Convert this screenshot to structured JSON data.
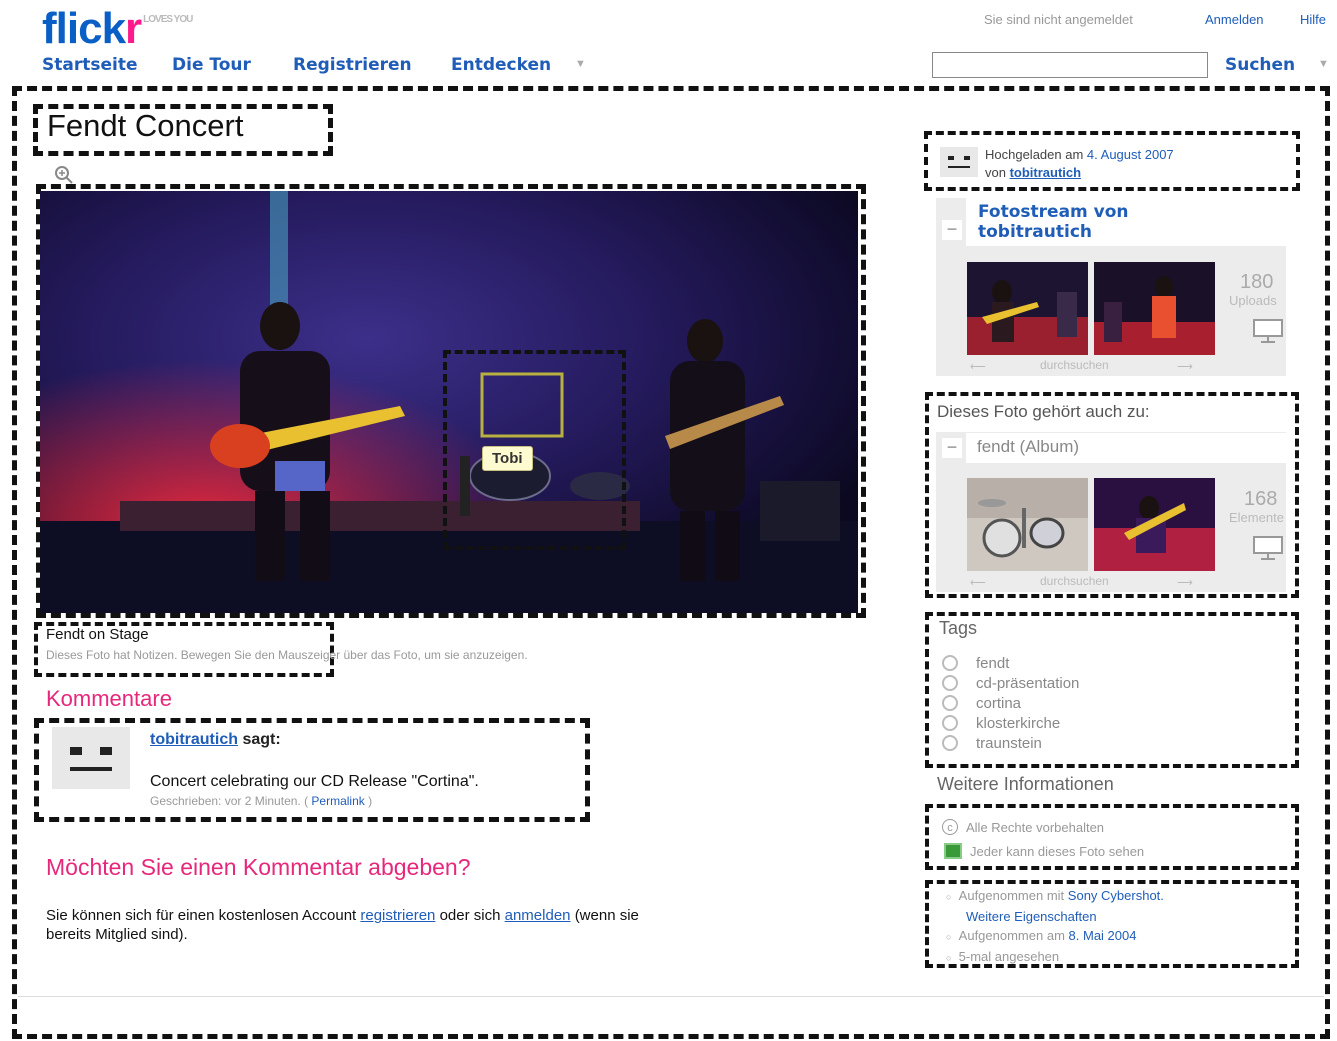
{
  "header": {
    "logo_text": "flickr",
    "logo_badge": "LOVES YOU",
    "not_logged_in": "Sie sind nicht angemeldet",
    "login_link": "Anmelden",
    "help_link": "Hilfe",
    "nav": [
      "Startseite",
      "Die Tour",
      "Registrieren",
      "Entdecken"
    ],
    "search_button": "Suchen",
    "search_placeholder": ""
  },
  "photo": {
    "title": "Fendt Concert",
    "note_label": "Tobi",
    "caption": "Fendt on Stage",
    "notes_hint": "Dieses Foto hat Notizen. Bewegen Sie den Mauszeiger über das Foto, um sie anzuzeigen."
  },
  "comments": {
    "heading": "Kommentare",
    "items": [
      {
        "author": "tobitrautich",
        "says": "sagt:",
        "text": "Concert celebrating our CD Release \"Cortina\".",
        "meta_prefix": "Geschrieben: vor 2 Minuten. (",
        "permalink": "Permalink",
        "meta_suffix": ")"
      }
    ],
    "prompt_heading": "Möchten Sie einen Kommentar abgeben?",
    "prompt_text_1": "Sie können sich für einen kostenlosen Account",
    "register_link": "registrieren",
    "prompt_text_2": "oder sich",
    "login_link": "anmelden",
    "prompt_text_3": "(wenn sie",
    "prompt_text_4": "bereits Mitglied sind)."
  },
  "sidebar": {
    "uploaded_prefix": "Hochgeladen am",
    "uploaded_date": "4. August 2007",
    "by_prefix": "von",
    "owner": "tobitrautich",
    "photostream_title_1": "Fotostream von",
    "photostream_title_2": "tobitrautich",
    "uploads_count": "180",
    "uploads_label": "Uploads",
    "browse_label": "durchsuchen",
    "belongs_heading": "Dieses Foto gehört auch zu:",
    "album_title": "fendt (Album)",
    "album_count": "168",
    "album_label": "Elemente",
    "tags_heading": "Tags",
    "tags": [
      "fendt",
      "cd-präsentation",
      "cortina",
      "klosterkirche",
      "traunstein"
    ],
    "more_info_heading": "Weitere Informationen",
    "rights": "Alle Rechte vorbehalten",
    "visibility": "Jeder kann dieses Foto sehen",
    "taken_with_prefix": "Aufgenommen mit",
    "camera": "Sony Cybershot.",
    "more_props": "Weitere Eigenschaften",
    "taken_on_prefix": "Aufgenommen am",
    "taken_date": "8. Mai 2004",
    "views": "5-mal angesehen"
  },
  "colors": {
    "link_blue": "#1f5db8",
    "pink": "#e6287b",
    "logo_blue": "#0a5fc6",
    "logo_pink": "#ff1a8c"
  }
}
